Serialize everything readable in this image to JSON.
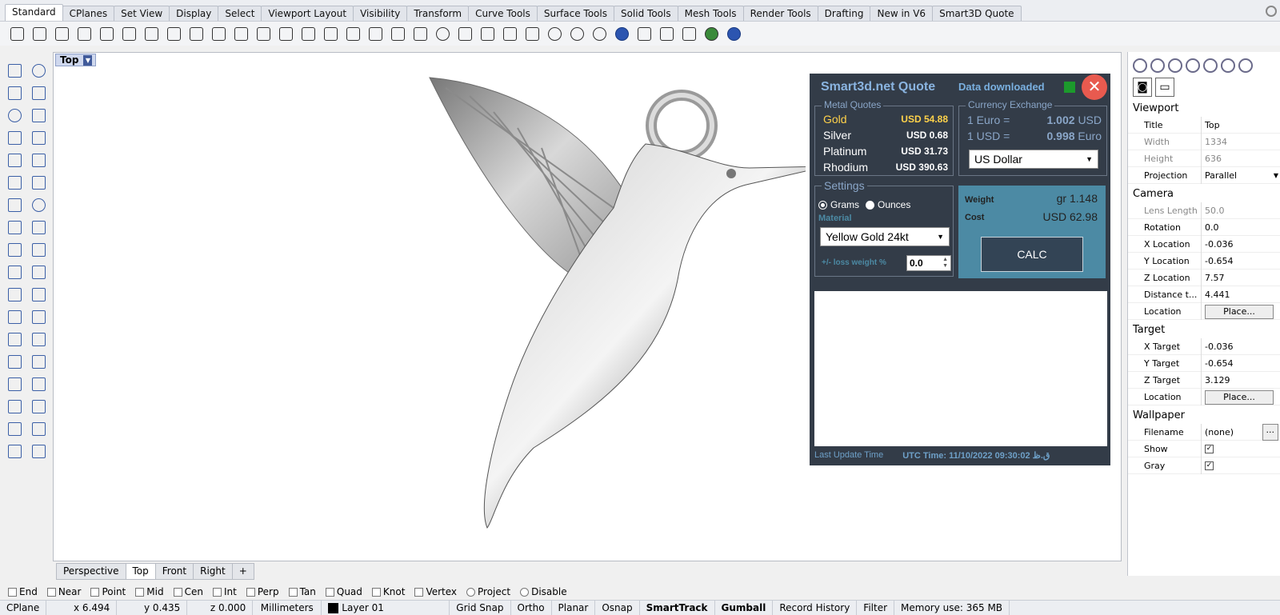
{
  "tabs": [
    "Standard",
    "CPlanes",
    "Set View",
    "Display",
    "Select",
    "Viewport Layout",
    "Visibility",
    "Transform",
    "Curve Tools",
    "Surface Tools",
    "Solid Tools",
    "Mesh Tools",
    "Render Tools",
    "Drafting",
    "New in V6",
    "Smart3D Quote"
  ],
  "active_tab": "Standard",
  "viewport": {
    "label": "Top"
  },
  "viewport_tabs": [
    "Perspective",
    "Top",
    "Front",
    "Right"
  ],
  "quote": {
    "title": "Smart3d.net Quote",
    "status": "Data downloaded",
    "status_color": "#1c9a2c",
    "metal_quotes": {
      "title": "Metal Quotes",
      "rows": [
        {
          "name": "Gold",
          "value": "USD 54.88",
          "color": "#ffd24a"
        },
        {
          "name": "Silver",
          "value": "USD 0.68",
          "color": "#ffffff"
        },
        {
          "name": "Platinum",
          "value": "USD 31.73",
          "color": "#ffffff"
        },
        {
          "name": "Rhodium",
          "value": "USD 390.63",
          "color": "#ffffff"
        }
      ]
    },
    "currency": {
      "title": "Currency Exchange",
      "row1_left": "1 Euro =",
      "row1_val": "1.002",
      "row1_unit": "USD",
      "row2_left": "1 USD =",
      "row2_val": "0.998",
      "row2_unit": "Euro",
      "selected": "US Dollar"
    },
    "settings": {
      "title": "Settings",
      "unit_grams": "Grams",
      "unit_ounces": "Ounces",
      "material_label": "Material",
      "material": "Yellow Gold 24kt",
      "loss_label": "+/- loss weight %",
      "loss_value": "0.0"
    },
    "result": {
      "weight_label": "Weight",
      "weight_value": "gr 1.148",
      "cost_label": "Cost",
      "cost_value": "USD  62.98",
      "calc_label": "CALC"
    },
    "footer": {
      "label": "Last Update Time",
      "value": "UTC Time: 11/10/2022 09:30:02 ق.ظ"
    }
  },
  "osnaps": [
    "End",
    "Near",
    "Point",
    "Mid",
    "Cen",
    "Int",
    "Perp",
    "Tan",
    "Quad",
    "Knot",
    "Vertex",
    "Project",
    "Disable"
  ],
  "status_bar": {
    "cplane": "CPlane",
    "x": "x 6.494",
    "y": "y 0.435",
    "z": "z 0.000",
    "units": "Millimeters",
    "layer": "Layer 01",
    "toggles": [
      "Grid Snap",
      "Ortho",
      "Planar",
      "Osnap",
      "SmartTrack",
      "Gumball",
      "Record History",
      "Filter"
    ],
    "bold_toggles": [
      "SmartTrack",
      "Gumball"
    ],
    "memory": "Memory use: 365 MB"
  },
  "properties": {
    "viewport_section": "Viewport",
    "title_label": "Title",
    "title_value": "Top",
    "width_label": "Width",
    "width_value": "1334",
    "height_label": "Height",
    "height_value": "636",
    "projection_label": "Projection",
    "projection_value": "Parallel",
    "camera_section": "Camera",
    "lens_label": "Lens Length",
    "lens_value": "50.0",
    "rotation_label": "Rotation",
    "rotation_value": "0.0",
    "xloc_label": "X Location",
    "xloc_value": "-0.036",
    "yloc_label": "Y Location",
    "yloc_value": "-0.654",
    "zloc_label": "Z Location",
    "zloc_value": "7.57",
    "dist_label": "Distance t...",
    "dist_value": "4.441",
    "loc_label": "Location",
    "place_label": "Place...",
    "target_section": "Target",
    "xt_label": "X Target",
    "xt_value": "-0.036",
    "yt_label": "Y Target",
    "yt_value": "-0.654",
    "zt_label": "Z Target",
    "zt_value": "3.129",
    "tloc_label": "Location",
    "wallpaper_section": "Wallpaper",
    "file_label": "Filename",
    "file_value": "(none)",
    "show_label": "Show",
    "gray_label": "Gray"
  }
}
